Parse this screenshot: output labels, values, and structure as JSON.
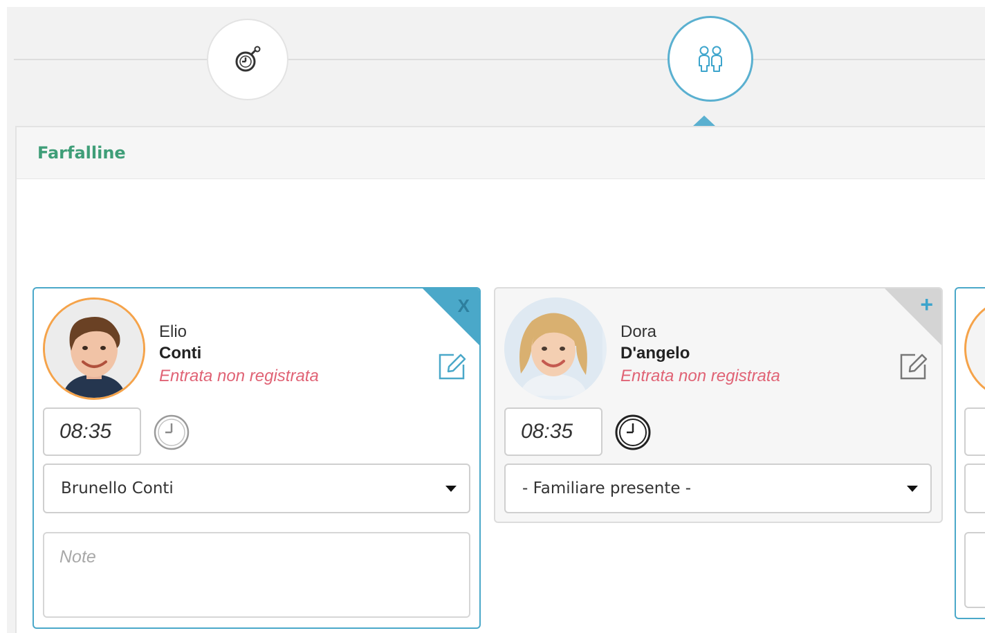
{
  "steps": [
    {
      "icon": "stopwatch-icon",
      "active": false
    },
    {
      "icon": "children-icon",
      "active": true
    }
  ],
  "panel": {
    "title": "Farfalline"
  },
  "cards": [
    {
      "first_name": "Elio",
      "last_name": "Conti",
      "status": "Entrata non registrata",
      "time": "08:35",
      "relative": "Brunello Conti",
      "note_placeholder": "Note",
      "corner_action": "X",
      "selected": true
    },
    {
      "first_name": "Dora",
      "last_name": "D'angelo",
      "status": "Entrata non registrata",
      "time": "08:35",
      "relative": "- Familiare presente -",
      "corner_action": "+",
      "selected": false
    }
  ],
  "colors": {
    "accent": "#4aa8c9",
    "title_green": "#3f9e78",
    "status_red": "#e06375",
    "avatar_ring": "#f5a34a"
  }
}
